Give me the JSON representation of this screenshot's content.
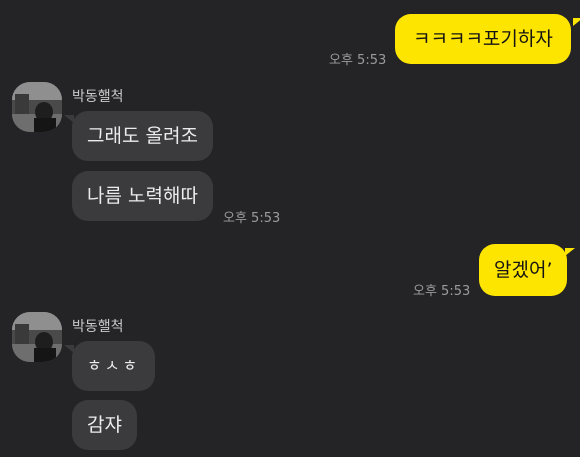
{
  "chat": {
    "messages": [
      {
        "text": "ㅋㅋㅋㅋ포기하자",
        "time": "오후 5:53"
      },
      {
        "sender": "박동핼척",
        "text": "그래도 올려조"
      },
      {
        "text": "나름 노력해따",
        "time": "오후 5:53"
      },
      {
        "text": "알겠어’",
        "time": "오후 5:53"
      },
      {
        "sender": "박동핼척",
        "text": "ㅎㅅㅎ"
      },
      {
        "text": "감쟈"
      }
    ]
  },
  "icons": {
    "avatar": "profile-photo-avatar"
  },
  "colors": {
    "background": "#242426",
    "outgoing_bubble": "#fee500",
    "incoming_bubble": "#3b3b3d",
    "timestamp": "#9b9b9d"
  }
}
